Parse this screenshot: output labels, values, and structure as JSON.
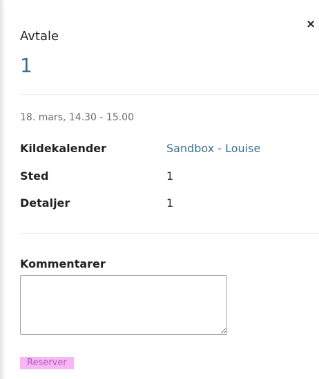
{
  "header": {
    "label": "Avtale",
    "title": "1"
  },
  "close_icon": "×",
  "event": {
    "date_time": "18. mars, 14.30 - 15.00",
    "rows": [
      {
        "label": "Kildekalender",
        "value": "Sandbox - Louise",
        "is_link": true
      },
      {
        "label": "Sted",
        "value": "1",
        "is_link": false
      },
      {
        "label": "Detaljer",
        "value": "1",
        "is_link": false
      }
    ]
  },
  "comments": {
    "label": "Kommentarer",
    "value": ""
  },
  "actions": {
    "reserve_label": "Reserver"
  },
  "colors": {
    "accent": "#3b6f8e",
    "reserve_bg": "#f7b7f7",
    "reserve_text": "#b35ab6"
  }
}
